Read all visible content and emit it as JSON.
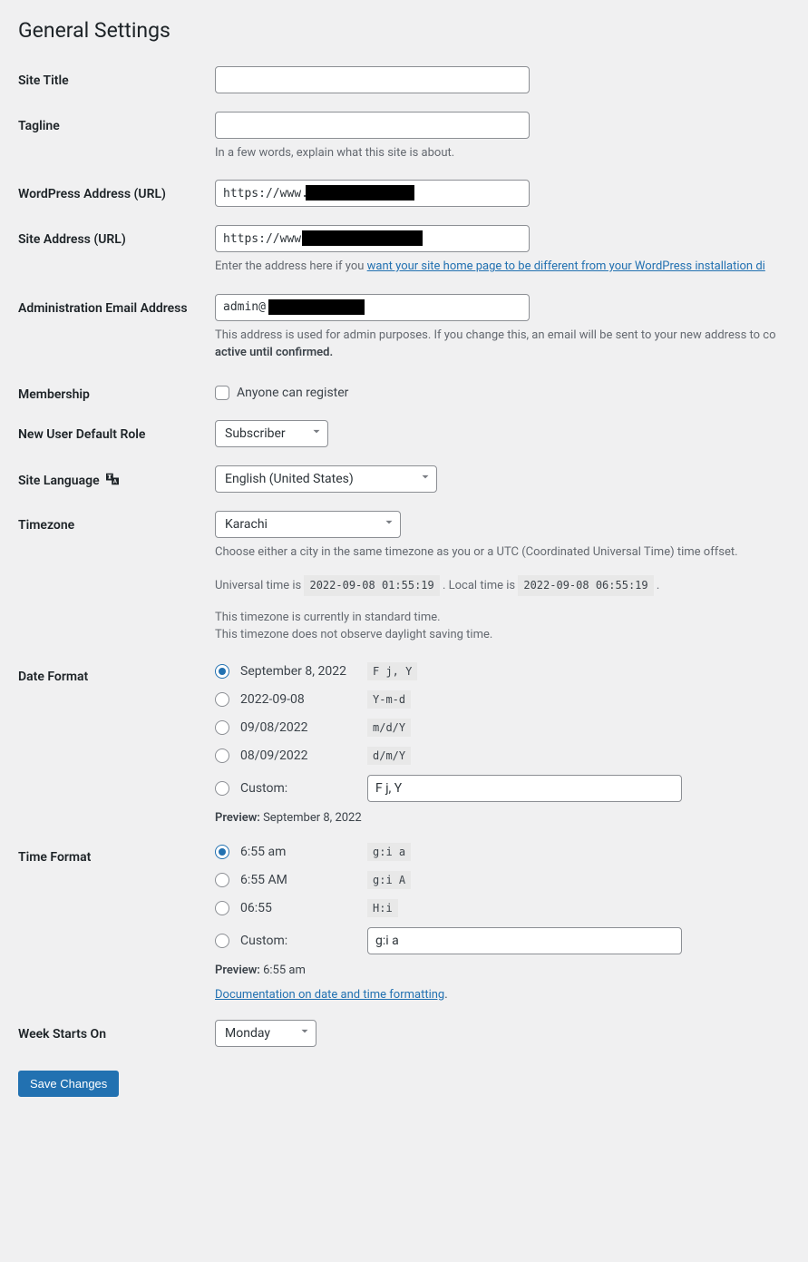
{
  "page": {
    "title": "General Settings"
  },
  "fields": {
    "site_title": {
      "label": "Site Title",
      "value": ""
    },
    "tagline": {
      "label": "Tagline",
      "value": "",
      "desc": "In a few words, explain what this site is about."
    },
    "wp_url": {
      "label": "WordPress Address (URL)",
      "prefix": "https://www."
    },
    "site_url": {
      "label": "Site Address (URL)",
      "prefix": "https://www",
      "desc_pre": "Enter the address here if you ",
      "desc_link": "want your site home page to be different from your WordPress installation di"
    },
    "admin_email": {
      "label": "Administration Email Address",
      "prefix": "admin@",
      "desc_pre": "This address is used for admin purposes. If you change this, an email will be sent to your new address to co",
      "desc_bold": "active until confirmed."
    },
    "membership": {
      "label": "Membership",
      "checkbox_label": "Anyone can register"
    },
    "default_role": {
      "label": "New User Default Role",
      "value": "Subscriber"
    },
    "site_language": {
      "label": "Site Language",
      "value": "English (United States)"
    },
    "timezone": {
      "label": "Timezone",
      "value": "Karachi",
      "desc": "Choose either a city in the same timezone as you or a UTC (Coordinated Universal Time) time offset.",
      "utc_pre": "Universal time is ",
      "utc_val": "2022-09-08 01:55:19",
      "local_pre": " . Local time is ",
      "local_val": "2022-09-08 06:55:19",
      "note1": "This timezone is currently in standard time.",
      "note2": "This timezone does not observe daylight saving time."
    },
    "date_format": {
      "label": "Date Format",
      "options": [
        {
          "display": "September 8, 2022",
          "code": "F j, Y",
          "checked": true
        },
        {
          "display": "2022-09-08",
          "code": "Y-m-d",
          "checked": false
        },
        {
          "display": "09/08/2022",
          "code": "m/d/Y",
          "checked": false
        },
        {
          "display": "08/09/2022",
          "code": "d/m/Y",
          "checked": false
        }
      ],
      "custom_label": "Custom:",
      "custom_value": "F j, Y",
      "preview_label": "Preview:",
      "preview_value": "September 8, 2022"
    },
    "time_format": {
      "label": "Time Format",
      "options": [
        {
          "display": "6:55 am",
          "code": "g:i a",
          "checked": true
        },
        {
          "display": "6:55 AM",
          "code": "g:i A",
          "checked": false
        },
        {
          "display": "06:55",
          "code": "H:i",
          "checked": false
        }
      ],
      "custom_label": "Custom:",
      "custom_value": "g:i a",
      "preview_label": "Preview:",
      "preview_value": "6:55 am",
      "doc_link": "Documentation on date and time formatting"
    },
    "week_start": {
      "label": "Week Starts On",
      "value": "Monday"
    }
  },
  "submit": {
    "label": "Save Changes"
  }
}
